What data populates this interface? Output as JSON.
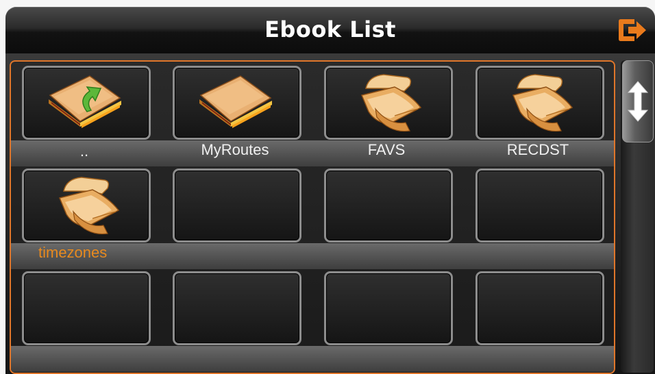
{
  "header": {
    "title": "Ebook List",
    "exit_icon": "exit-icon"
  },
  "accent_color": "#e0762a",
  "selected_label_color": "#e88a1e",
  "grid": {
    "columns": 4,
    "rows": 3,
    "items": [
      {
        "label": "..",
        "icon": "parent-folder-icon",
        "selected": false
      },
      {
        "label": "MyRoutes",
        "icon": "folder-icon",
        "selected": false
      },
      {
        "label": "FAVS",
        "icon": "scroll-file-icon",
        "selected": false
      },
      {
        "label": "RECDST",
        "icon": "scroll-file-icon",
        "selected": false
      },
      {
        "label": "timezones",
        "icon": "scroll-file-icon",
        "selected": true
      },
      {
        "label": "",
        "icon": "",
        "selected": false
      },
      {
        "label": "",
        "icon": "",
        "selected": false
      },
      {
        "label": "",
        "icon": "",
        "selected": false
      },
      {
        "label": "",
        "icon": "",
        "selected": false
      },
      {
        "label": "",
        "icon": "",
        "selected": false
      },
      {
        "label": "",
        "icon": "",
        "selected": false
      },
      {
        "label": "",
        "icon": "",
        "selected": false
      }
    ]
  },
  "scrollbar": {
    "thumb_icon": "up-down-arrow-icon"
  }
}
